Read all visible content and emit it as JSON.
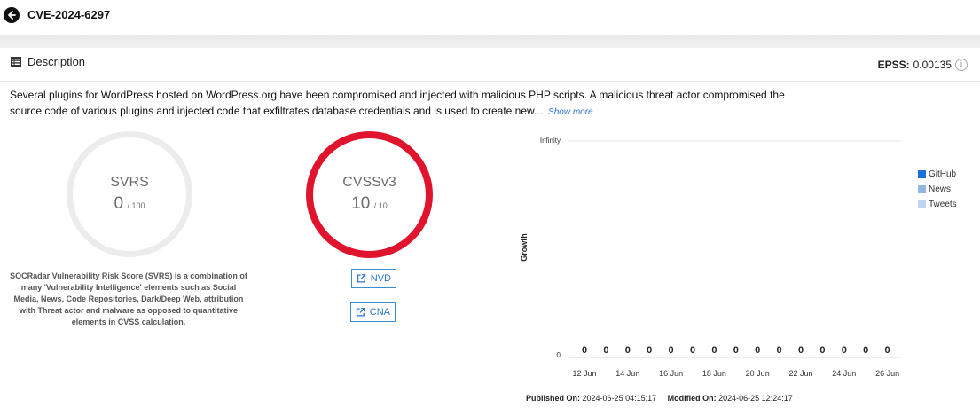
{
  "header": {
    "title": "CVE-2024-6297"
  },
  "description": {
    "heading": "Description",
    "text": "Several plugins for WordPress hosted on WordPress.org have been compromised and injected with malicious PHP scripts. A malicious threat actor compromised the source code of various plugins and injected code that exfiltrates database credentials and is used to create new...",
    "show_more": "Show more"
  },
  "epss": {
    "label": "EPSS:",
    "value": "0.00135"
  },
  "svrs": {
    "label": "SVRS",
    "value": "0",
    "max": "/ 100",
    "note": "SOCRadar Vulnerability Risk Score (SVRS) is a combination of many 'Vulnerability Intelligence' elements such as Social Media, News, Code Repositories, Dark/Deep Web, attribution with Threat actor and malware as opposed to quantitative elements in CVSS calculation."
  },
  "cvss": {
    "label": "CVSSv3",
    "value": "10",
    "max": "/ 10",
    "color": "#e0142d"
  },
  "links": {
    "nvd": "NVD",
    "cna": "CNA"
  },
  "chart_data": {
    "type": "bar",
    "ylabel": "Growth",
    "y_ticks": [
      "Infinity",
      "0"
    ],
    "x_ticks": [
      "12 Jun",
      "14 Jun",
      "16 Jun",
      "18 Jun",
      "20 Jun",
      "22 Jun",
      "24 Jun",
      "26 Jun"
    ],
    "data_labels": [
      "0",
      "0",
      "0",
      "0",
      "0",
      "0",
      "0",
      "0",
      "0",
      "0",
      "0",
      "0",
      "0",
      "0",
      "0"
    ],
    "series": [
      {
        "name": "GitHub",
        "color": "#1a6fd8",
        "values": [
          0,
          0,
          0,
          0,
          0,
          0,
          0,
          0,
          0,
          0,
          0,
          0,
          0,
          0,
          0
        ]
      },
      {
        "name": "News",
        "color": "#94b5e6",
        "values": [
          0,
          0,
          0,
          0,
          0,
          0,
          0,
          0,
          0,
          0,
          0,
          0,
          0,
          0,
          0
        ]
      },
      {
        "name": "Tweets",
        "color": "#c3d4ef",
        "values": [
          0,
          0,
          0,
          0,
          0,
          0,
          0,
          0,
          0,
          0,
          0,
          0,
          0,
          0,
          0
        ]
      }
    ]
  },
  "meta": {
    "published_label": "Published On:",
    "published_value": "2024-06-25 04:15:17",
    "modified_label": "Modified On:",
    "modified_value": "2024-06-25 12:24:17"
  }
}
